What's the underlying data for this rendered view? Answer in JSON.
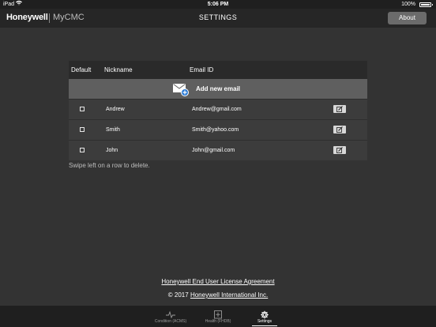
{
  "status_bar": {
    "device": "iPad",
    "time": "5:06 PM",
    "battery": "100%"
  },
  "nav": {
    "brand": "Honeywell",
    "app_name": "MyCMC",
    "title": "SETTINGS",
    "about_label": "About"
  },
  "table": {
    "headers": {
      "default": "Default",
      "nickname": "Nickname",
      "email": "Email ID"
    },
    "add_label": "Add new email",
    "rows": [
      {
        "nickname": "Andrew",
        "email": "Andrew@gmail.com",
        "default": false
      },
      {
        "nickname": "Smith",
        "email": "Smith@yahoo.com",
        "default": false
      },
      {
        "nickname": "John",
        "email": "John@gmail.com",
        "default": false
      }
    ],
    "hint": "Swipe left on a row to delete."
  },
  "footer": {
    "eula": "Honeywell End User License Agreement",
    "copyright_prefix": "© 2017",
    "company": "Honeywell International Inc."
  },
  "tabs": [
    {
      "label": "Condition (ACMS)",
      "icon": "pulse-icon",
      "active": false
    },
    {
      "label": "Health (FHDB)",
      "icon": "health-plus-icon",
      "active": false
    },
    {
      "label": "Settings",
      "icon": "gear-icon",
      "active": true
    }
  ]
}
